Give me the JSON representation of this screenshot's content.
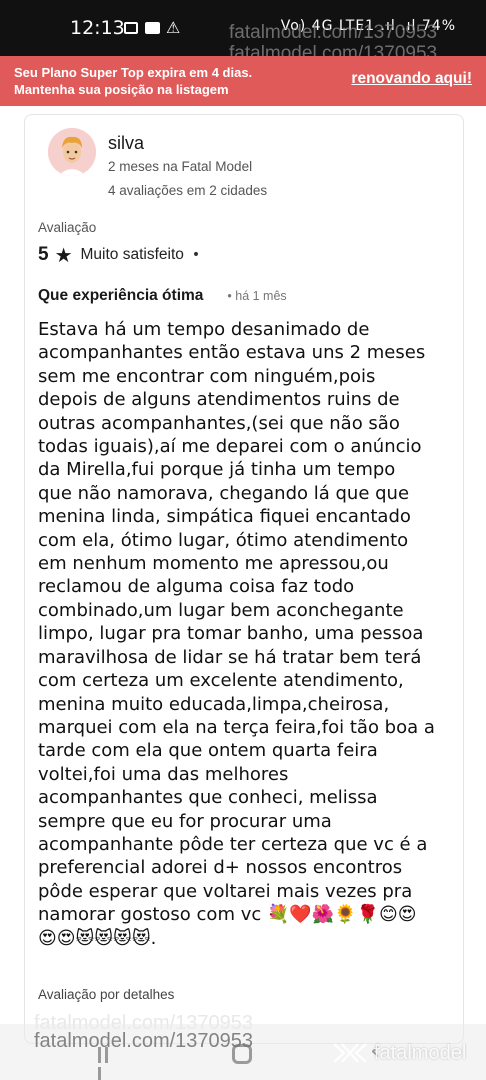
{
  "status_bar": {
    "time": "12:13",
    "right_text": "Vo) 4G LTE1 .ıl .ıl 74%",
    "icons": [
      "gallery-icon",
      "ad-icon",
      "warning-icon",
      "alarm-icon",
      "mute-icon",
      "signal-icon",
      "battery-icon"
    ]
  },
  "watermark": {
    "top_line1": "fatalmodel.com/1370953",
    "top_line2": "fatalmodel.com/1370953",
    "bottom": "fatalmodel.com/1370953",
    "bottom_ghost": "fatalmodel.com/1370953"
  },
  "banner": {
    "line1": "Seu Plano Super Top expira em 4 dias.",
    "line2": "Mantenha sua posição na listagem",
    "link": "renovando aqui!",
    "color": "#e15a5a"
  },
  "review": {
    "author": "silva",
    "member_since": "2 meses na Fatal Model",
    "stats": "4 avaliações em 2 cidades",
    "rating_label": "Avaliação",
    "rating_value": "5",
    "rating_star": "★",
    "rating_text": "Muito satisfeito",
    "rating_sep": "•",
    "title": "Que experiência ótima",
    "time": "•   há 1 mês",
    "body_lines": [
      "Estava há um tempo desanimado de",
      "acompanhantes então estava uns 2 meses",
      "sem me encontrar com ninguém,pois",
      "depois de alguns atendimentos ruins de",
      "outras acompanhantes,(sei que não são",
      "todas iguais),aí me deparei com o anúncio",
      "da Mirella,fui porque já tinha um tempo",
      "que não namorava, chegando lá que que",
      "menina linda, simpática fiquei encantado",
      "com ela, ótimo lugar, ótimo atendimento",
      "em nenhum momento me apressou,ou",
      "reclamou de alguma coisa faz todo",
      "combinado,um lugar bem aconchegante",
      "limpo, lugar pra tomar banho, uma pessoa",
      "maravilhosa de lidar se há tratar bem terá",
      "com certeza um excelente atendimento,",
      "menina muito educada,limpa,cheirosa,",
      "marquei com ela na terça feira,foi tão boa a",
      "tarde com ela que ontem quarta feira",
      "voltei,foi uma das melhores",
      "acompanhantes que conheci, melissa",
      "sempre que eu for procurar uma",
      "acompanhante pôde ter certeza que vc é a",
      "preferencial adorei d+ nossos encontros",
      "pôde esperar que voltarei mais vezes pra",
      "namorar gostoso com vc 💐❤️🌺🌻🌹😊😍",
      "😍😍😻😻😻😻."
    ],
    "details_label": "Avaliação por detalhes"
  },
  "brand": {
    "name": "fatalmodel"
  }
}
